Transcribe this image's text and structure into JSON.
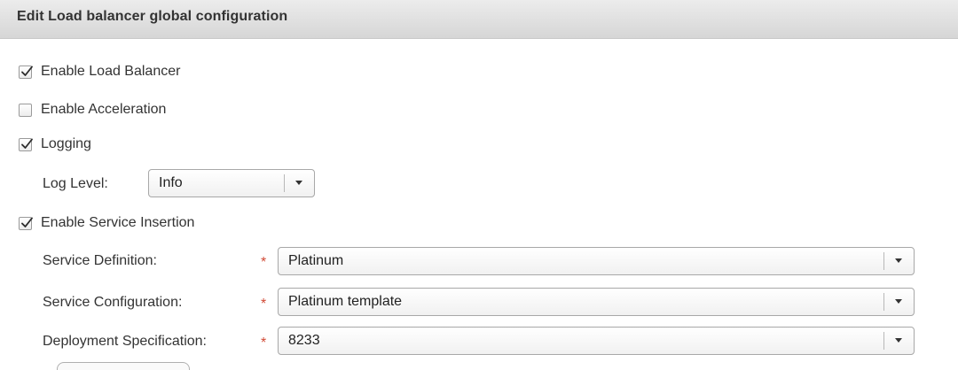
{
  "dialog": {
    "title": "Edit Load balancer global configuration"
  },
  "options": {
    "enable_load_balancer": {
      "label": "Enable Load Balancer",
      "checked": true
    },
    "enable_acceleration": {
      "label": "Enable Acceleration",
      "checked": false
    },
    "logging": {
      "label": "Logging",
      "checked": true
    },
    "enable_service_insertion": {
      "label": "Enable Service Insertion",
      "checked": true
    }
  },
  "log_level": {
    "label": "Log Level:",
    "value": "Info"
  },
  "service_definition": {
    "label": "Service Definition:",
    "required_mark": "*",
    "value": "Platinum"
  },
  "service_configuration": {
    "label": "Service Configuration:",
    "required_mark": "*",
    "value": "Platinum template"
  },
  "deployment_specification": {
    "label": "Deployment Specification:",
    "required_mark": "*",
    "value": "8233"
  },
  "icons": {
    "check": "checkmark-icon",
    "dropdown": "triangle-down-icon"
  },
  "colors": {
    "required": "#d14a36",
    "titlebar": "#dcdcdc",
    "text": "#333333"
  }
}
